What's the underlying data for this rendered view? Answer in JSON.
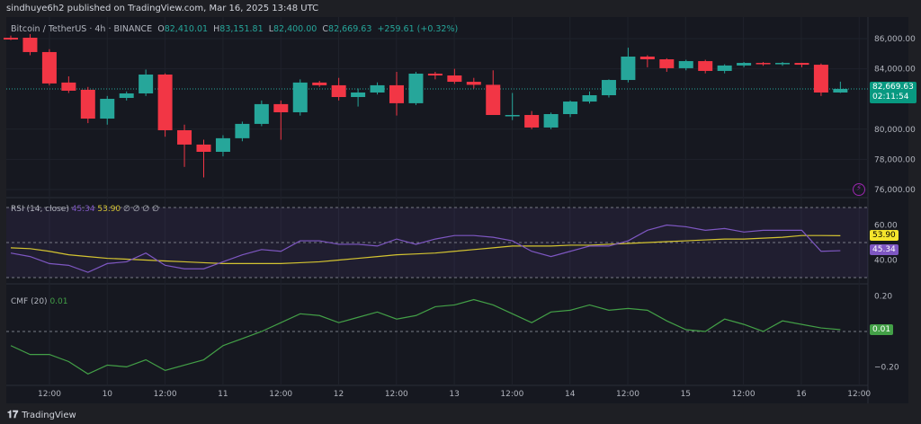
{
  "header": {
    "published": "sindhuye6h2 published on TradingView.com, Mar 16, 2025 13:48 UTC"
  },
  "legend": {
    "symbol": "Bitcoin / TetherUS · 4h · BINANCE",
    "o_label": "O",
    "o": "82,410.01",
    "h_label": "H",
    "h": "83,151.81",
    "l_label": "L",
    "l": "82,400.00",
    "c_label": "C",
    "c": "82,669.63",
    "change": "+259.61 (+0.32%)"
  },
  "price_tag": {
    "price": "82,669.63",
    "countdown": "02:11:54"
  },
  "rsi": {
    "label": "RSI (14, close)",
    "value": "45.34",
    "ma_value": "53.90",
    "extras": "∅ ∅ ∅ ∅",
    "tag_rsi": "45.34",
    "tag_ma": "53.90"
  },
  "cmf": {
    "label": "CMF (20)",
    "value": "0.01",
    "tag": "0.01"
  },
  "footer": {
    "brand": "TradingView"
  },
  "colors": {
    "up": "#26a69a",
    "down": "#f23645",
    "rsi": "#7e57c2",
    "rsi_ma": "#d4c431",
    "cmf": "#43a047"
  },
  "chart_data": [
    {
      "type": "candlestick",
      "title": "Bitcoin / TetherUS · 4h · BINANCE",
      "yticks": [
        "86,000.00",
        "84,000.00",
        "80,000.00",
        "78,000.00",
        "76,000.00"
      ],
      "ylim": [
        75500,
        86500
      ],
      "xticks": [
        "12:00",
        "10",
        "12:00",
        "11",
        "12:00",
        "12",
        "12:00",
        "13",
        "12:00",
        "14",
        "12:00",
        "15",
        "12:00",
        "16",
        "12:00"
      ],
      "ohlc": [
        [
          86060,
          86200,
          85900,
          85940
        ],
        [
          86060,
          86300,
          84900,
          85110
        ],
        [
          85110,
          85300,
          82900,
          83030
        ],
        [
          83090,
          83500,
          82400,
          82550
        ],
        [
          82610,
          82800,
          80400,
          80700
        ],
        [
          80700,
          82200,
          80300,
          82010
        ],
        [
          82070,
          82500,
          81900,
          82370
        ],
        [
          82370,
          83950,
          82200,
          83620
        ],
        [
          83620,
          83700,
          79500,
          79930
        ],
        [
          79930,
          80300,
          77500,
          78980
        ],
        [
          78980,
          79300,
          76800,
          78500
        ],
        [
          78500,
          79600,
          78200,
          79400
        ],
        [
          79400,
          80500,
          79200,
          80350
        ],
        [
          80350,
          81900,
          80200,
          81660
        ],
        [
          81660,
          81900,
          79300,
          81120
        ],
        [
          81120,
          83300,
          80900,
          83090
        ],
        [
          83090,
          83200,
          82800,
          82910
        ],
        [
          82910,
          83400,
          81900,
          82130
        ],
        [
          82130,
          82700,
          81500,
          82430
        ],
        [
          82430,
          83100,
          82300,
          82910
        ],
        [
          82910,
          83800,
          80900,
          81720
        ],
        [
          81720,
          83800,
          81600,
          83680
        ],
        [
          83680,
          83800,
          83300,
          83560
        ],
        [
          83560,
          84000,
          83000,
          83140
        ],
        [
          83140,
          83400,
          82700,
          82940
        ],
        [
          82940,
          83900,
          82500,
          80940
        ],
        [
          80940,
          82400,
          80600,
          80940
        ],
        [
          80940,
          81200,
          80000,
          80110
        ],
        [
          80110,
          81100,
          80000,
          81000
        ],
        [
          81000,
          81900,
          80800,
          81830
        ],
        [
          81830,
          82500,
          81700,
          82250
        ],
        [
          82250,
          83300,
          82100,
          83260
        ],
        [
          83260,
          85400,
          83100,
          84810
        ],
        [
          84810,
          84900,
          84100,
          84630
        ],
        [
          84630,
          84700,
          83800,
          84040
        ],
        [
          84040,
          84600,
          83900,
          84510
        ],
        [
          84510,
          84600,
          83700,
          83860
        ],
        [
          83860,
          84300,
          83700,
          84220
        ],
        [
          84220,
          84450,
          84100,
          84390
        ],
        [
          84390,
          84450,
          84200,
          84330
        ],
        [
          84330,
          84450,
          84200,
          84390
        ],
        [
          84390,
          84400,
          84100,
          84270
        ],
        [
          84270,
          84350,
          82200,
          82430
        ],
        [
          82430,
          83150,
          82400,
          82670
        ]
      ]
    },
    {
      "type": "line",
      "title": "RSI (14, close)",
      "ylim": [
        25,
        75
      ],
      "yticks": [
        "60.00",
        "40.00"
      ],
      "bands": [
        30,
        50,
        70
      ],
      "series": [
        {
          "name": "RSI",
          "values": [
            44,
            42,
            38,
            37,
            33,
            38,
            39,
            44,
            37,
            35,
            35,
            39,
            43,
            46,
            45,
            51,
            51,
            49,
            49,
            48,
            52,
            49,
            52,
            54,
            54,
            53,
            51,
            45,
            42,
            45,
            48,
            48,
            51,
            57,
            60,
            59,
            57,
            58,
            56,
            57,
            57,
            57,
            45,
            45.34
          ]
        },
        {
          "name": "RSI MA",
          "values": [
            47,
            46.5,
            45,
            43,
            42,
            41,
            40.5,
            40,
            39.5,
            39,
            38.5,
            38,
            38,
            38,
            38,
            38.5,
            39,
            40,
            41,
            42,
            43,
            43.5,
            44,
            45,
            46,
            47,
            48,
            48,
            48,
            48.5,
            48.5,
            49,
            49.5,
            50,
            50.5,
            51,
            51.5,
            52,
            52,
            52.5,
            53,
            54,
            54,
            53.9
          ]
        }
      ]
    },
    {
      "type": "line",
      "title": "CMF (20)",
      "ylim": [
        -0.27,
        0.27
      ],
      "yticks": [
        "0.20",
        "−0.20"
      ],
      "series": [
        {
          "name": "CMF",
          "values": [
            -0.08,
            -0.13,
            -0.13,
            -0.17,
            -0.24,
            -0.19,
            -0.2,
            -0.16,
            -0.22,
            -0.19,
            -0.16,
            -0.08,
            -0.04,
            0,
            0.05,
            0.1,
            0.09,
            0.05,
            0.08,
            0.11,
            0.07,
            0.09,
            0.14,
            0.15,
            0.18,
            0.15,
            0.1,
            0.05,
            0.11,
            0.12,
            0.15,
            0.12,
            0.13,
            0.12,
            0.06,
            0.01,
            0,
            0.07,
            0.04,
            0,
            0.06,
            0.04,
            0.02,
            0.01
          ]
        }
      ]
    }
  ]
}
